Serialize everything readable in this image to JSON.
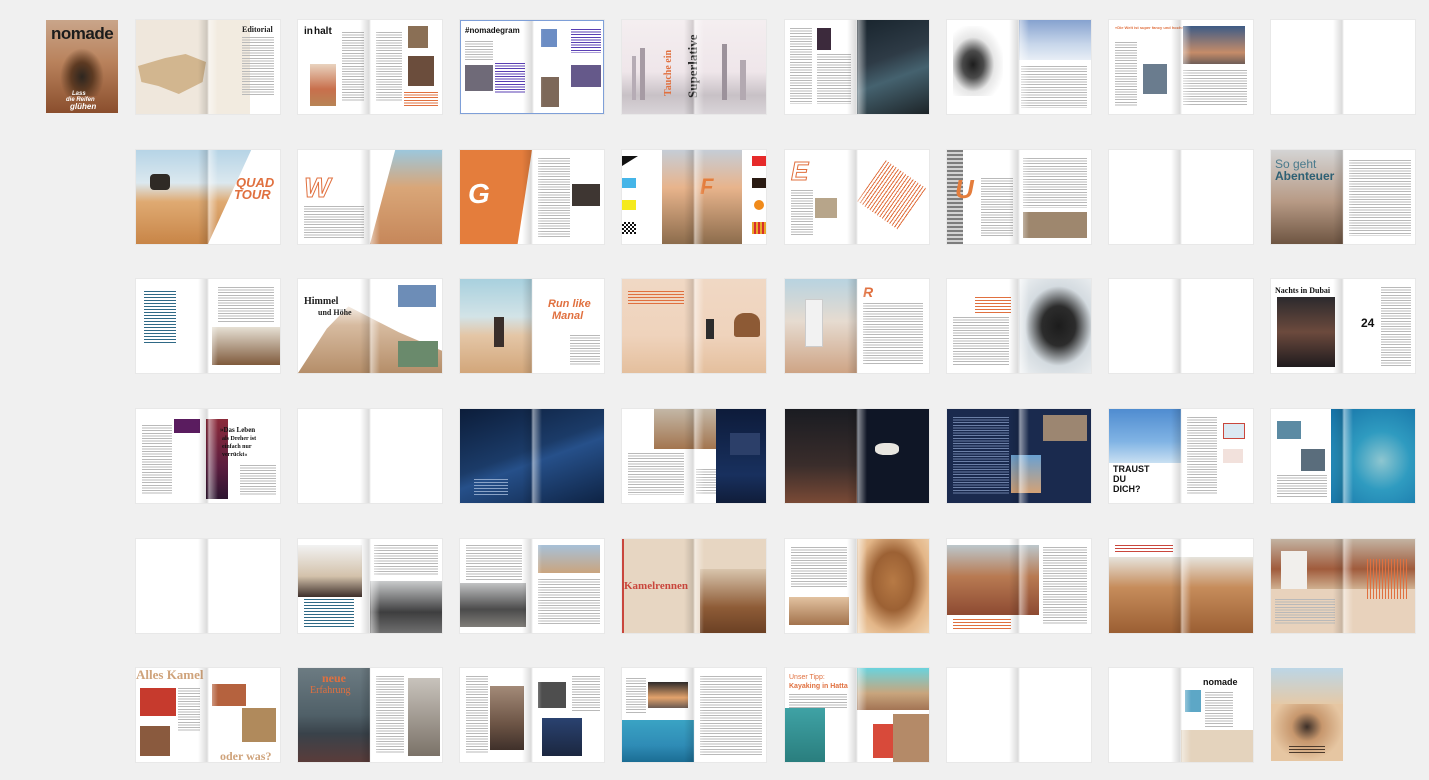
{
  "magazine": {
    "cover": {
      "masthead": "nomade",
      "headline_line1": "Lass",
      "headline_line2": "die Reifen",
      "headline_line3": "glühen"
    },
    "back_cover": {
      "credit": ""
    }
  },
  "headlines": {
    "editorial": "Editorial",
    "inhalt_a": "in",
    "inhalt_b": "halt",
    "nomadegram": "#nomadegram",
    "superlative_a": "Superlative",
    "superlative_b": "Tauche ein",
    "quote_world": "»Die Welt ist super fancy und hochmodern«",
    "quad_tour_a": "QUAD",
    "quad_tour_b": "TOUR",
    "letter_w": "W",
    "letter_g": "G",
    "letter_f": "F",
    "letter_e": "E",
    "letter_u": "U",
    "so_geht": "So geht",
    "abenteuer": "Abenteuer",
    "himmel_a": "Himmel",
    "himmel_b": "und Höhe",
    "run_like_a": "Run like",
    "run_like_b": "Manal",
    "letter_r": "R",
    "nachts": "Nachts in Dubai",
    "twentyfour": "24",
    "das_leben_a": "»Das Leben",
    "das_leben_b": "als Dreher ist",
    "das_leben_c": "einfach nur",
    "das_leben_d": "verrückt«",
    "traust_a": "TRAUST",
    "traust_b": "DU",
    "traust_c": "DICH?",
    "kamelrennen": "Kamelrennen",
    "alles_kamel": "Alles Kamel",
    "oder_was": "oder was?",
    "neue_a": "neue",
    "neue_b": "Erfahrung",
    "unser_tipp_a": "Unser Tipp:",
    "unser_tipp_b": "Kayaking in Hatta",
    "back_masthead": "nomade"
  }
}
